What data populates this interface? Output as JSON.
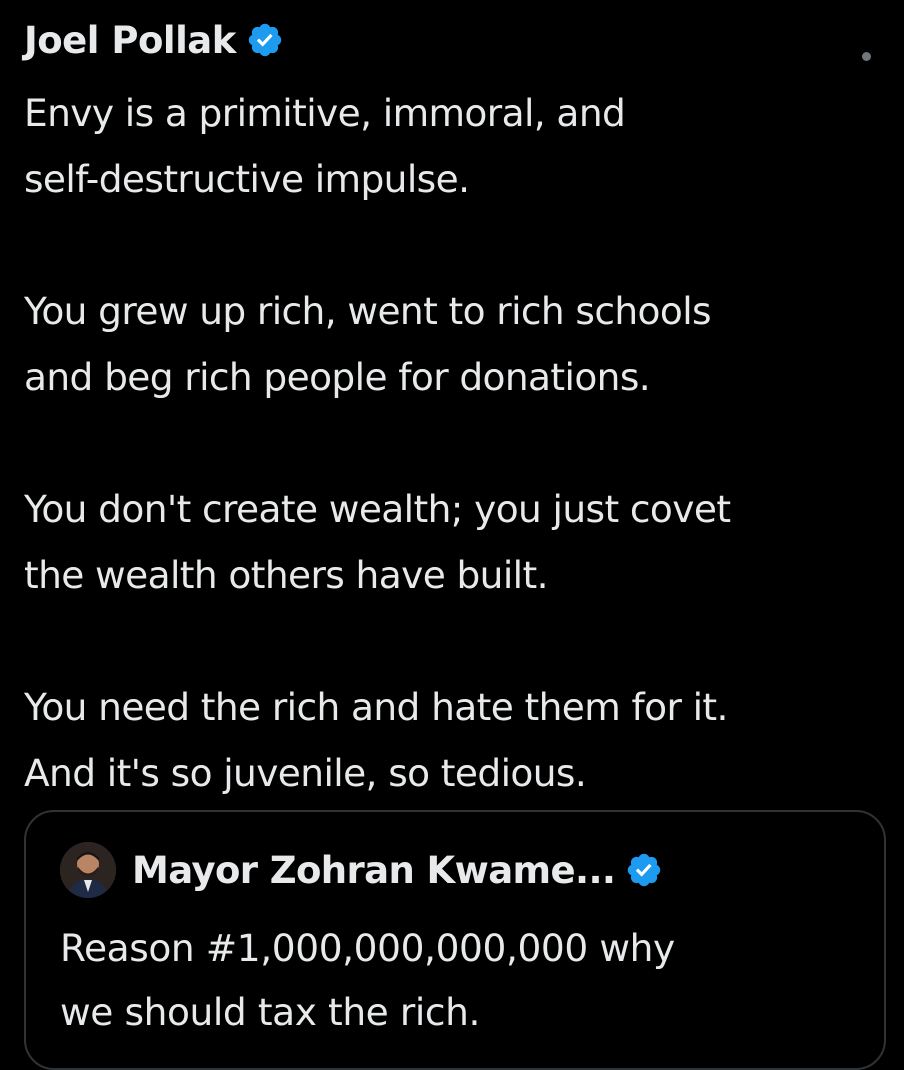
{
  "tweet": {
    "author_name": "Joel Pollak",
    "verified": true,
    "paragraphs": [
      "Envy is a primitive, immoral, and\nself-destructive impulse.",
      "You grew up rich, went to rich schools\nand beg rich people for donations.",
      "You don't create wealth; you just covet\nthe wealth others have built.",
      "You need the rich and hate them for it.\nAnd it's so juvenile, so tedious."
    ]
  },
  "quoted_tweet": {
    "author_name": "Mayor Zohran Kwame...",
    "verified": true,
    "text": "Reason #1,000,000,000,000 why\nwe should tax the rich."
  },
  "colors": {
    "background": "#000000",
    "text": "#e7e9ea",
    "verified_badge": "#1d9bf0",
    "border": "#2f3336",
    "muted": "#71767b"
  },
  "icons": {
    "verified": "verified-badge-icon",
    "more": "more-options-icon"
  }
}
